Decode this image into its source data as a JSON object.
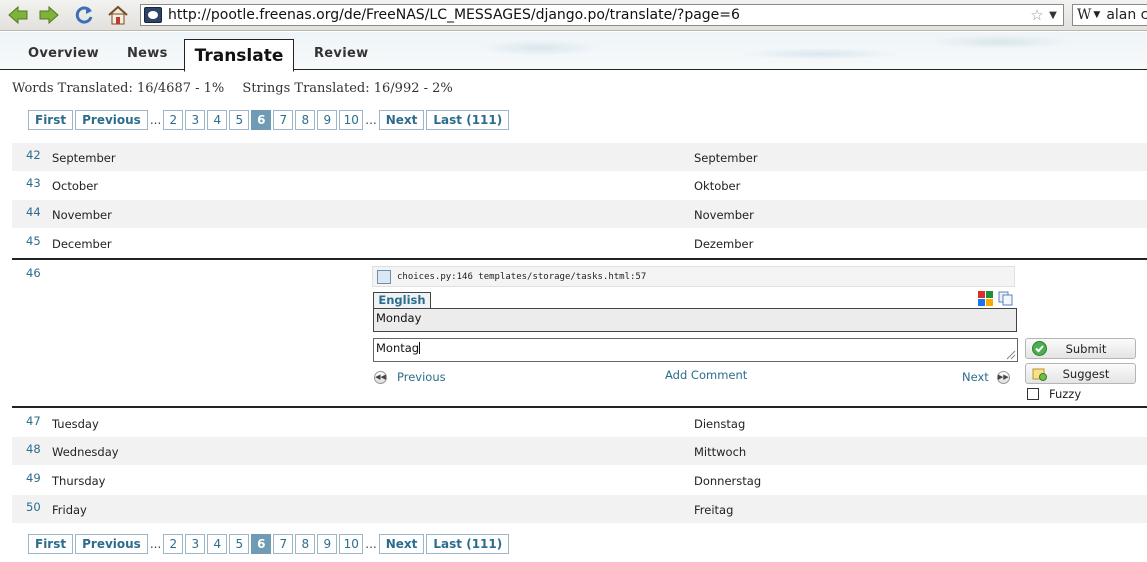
{
  "browser": {
    "url": "http://pootle.freenas.org/de/FreeNAS/LC_MESSAGES/django.po/translate/?page=6",
    "search_engine": "W",
    "search_text": "alan c"
  },
  "tabs": [
    "Overview",
    "News",
    "Translate",
    "Review"
  ],
  "active_tab": "Translate",
  "stats": {
    "words": "Words Translated: 16/4687 - 1%",
    "strings": "Strings Translated: 16/992 - 2%"
  },
  "pager": {
    "first": "First",
    "previous": "Previous",
    "ellipsis": "...",
    "pages": [
      "2",
      "3",
      "4",
      "5",
      "6",
      "7",
      "8",
      "9",
      "10"
    ],
    "current": "6",
    "next": "Next",
    "last": "Last (111)"
  },
  "rows_before": [
    {
      "num": "42",
      "source": "September",
      "target": "September"
    },
    {
      "num": "43",
      "source": "October",
      "target": "Oktober"
    },
    {
      "num": "44",
      "source": "November",
      "target": "November"
    },
    {
      "num": "45",
      "source": "December",
      "target": "Dezember"
    }
  ],
  "editor": {
    "num": "46",
    "locations": "choices.py:146 templates/storage/tasks.html:57",
    "source_lang": "English",
    "source_text": "Monday",
    "target_text": "Montag",
    "previous": "Previous",
    "add_comment": "Add Comment",
    "next": "Next",
    "submit": "Submit",
    "suggest": "Suggest",
    "fuzzy": "Fuzzy"
  },
  "rows_after": [
    {
      "num": "47",
      "source": "Tuesday",
      "target": "Dienstag"
    },
    {
      "num": "48",
      "source": "Wednesday",
      "target": "Mittwoch"
    },
    {
      "num": "49",
      "source": "Thursday",
      "target": "Donnerstag"
    },
    {
      "num": "50",
      "source": "Friday",
      "target": "Freitag"
    }
  ]
}
